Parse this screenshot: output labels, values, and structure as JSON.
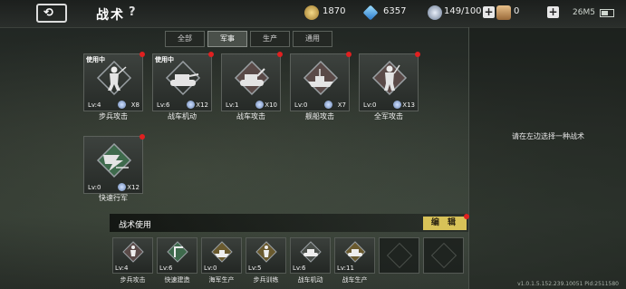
{
  "header": {
    "title": "战术",
    "help": "?",
    "gold": "1870",
    "diamonds": "6357",
    "stamina": "149/100",
    "extra": "0",
    "clock": "26M5"
  },
  "tabs": [
    {
      "label": "全部",
      "active": false
    },
    {
      "label": "军事",
      "active": true
    },
    {
      "label": "生产",
      "active": false
    },
    {
      "label": "通用",
      "active": false
    }
  ],
  "tactics": [
    {
      "name": "步兵攻击",
      "lv": "Lv:4",
      "count": "X8",
      "in_use": "使用中",
      "icon": "infantry-icon"
    },
    {
      "name": "战车机动",
      "lv": "Lv:6",
      "count": "X12",
      "in_use": "使用中",
      "icon": "tank-icon"
    },
    {
      "name": "战车攻击",
      "lv": "Lv:1",
      "count": "X10",
      "in_use": "",
      "icon": "tank-attack-icon"
    },
    {
      "name": "舰船攻击",
      "lv": "Lv:0",
      "count": "X7",
      "in_use": "",
      "icon": "ship-icon"
    },
    {
      "name": "全军攻击",
      "lv": "Lv:0",
      "count": "X13",
      "in_use": "",
      "icon": "soldier-icon"
    },
    {
      "name": "快速行军",
      "lv": "Lv:0",
      "count": "X12",
      "in_use": "",
      "icon": "march-icon"
    }
  ],
  "usage": {
    "title": "战术使用",
    "edit_label": "编 辑",
    "slots": [
      {
        "name": "步兵攻击",
        "lv": "Lv:4"
      },
      {
        "name": "快速建造",
        "lv": "Lv:6"
      },
      {
        "name": "海军生产",
        "lv": "Lv:0"
      },
      {
        "name": "步兵训练",
        "lv": "Lv:5"
      },
      {
        "name": "战车机动",
        "lv": "Lv:6"
      },
      {
        "name": "战车生产",
        "lv": "Lv:11"
      }
    ]
  },
  "right_hint": "请在左边选择一种战术",
  "version": "v1.0.1.5.152.239.10051 Pid:2511580",
  "colors": {
    "accent": "#d8c258",
    "alert": "#e02020"
  }
}
